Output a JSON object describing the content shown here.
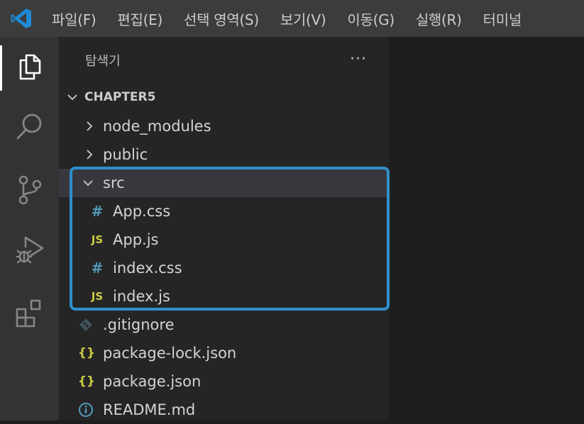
{
  "menu": {
    "items": [
      "파일(F)",
      "편집(E)",
      "선택 영역(S)",
      "보기(V)",
      "이동(G)",
      "실행(R)",
      "터미널"
    ]
  },
  "activity": {
    "icons": [
      "files-icon",
      "search-icon",
      "source-control-icon",
      "run-debug-icon",
      "extensions-icon"
    ]
  },
  "explorer": {
    "title": "탐색기",
    "more": "···",
    "root": "CHAPTER5",
    "items": [
      {
        "label": "node_modules",
        "icon": "chevron-right-icon"
      },
      {
        "label": "public",
        "icon": "chevron-right-icon"
      },
      {
        "label": "src",
        "icon": "chevron-down-icon"
      },
      {
        "label": "App.css",
        "icon": "css-file-icon",
        "glyph": "#"
      },
      {
        "label": "App.js",
        "icon": "js-file-icon",
        "glyph": "JS"
      },
      {
        "label": "index.css",
        "icon": "css-file-icon",
        "glyph": "#"
      },
      {
        "label": "index.js",
        "icon": "js-file-icon",
        "glyph": "JS"
      },
      {
        "label": ".gitignore",
        "icon": "git-file-icon"
      },
      {
        "label": "package-lock.json",
        "icon": "json-file-icon",
        "glyph": "{}"
      },
      {
        "label": "package.json",
        "icon": "json-file-icon",
        "glyph": "{}"
      },
      {
        "label": "README.md",
        "icon": "info-icon"
      }
    ]
  },
  "colors": {
    "titlebar": "#3c3c3c",
    "activitybar": "#333333",
    "sidebar": "#252526",
    "editor": "#1e1e1e",
    "highlight": "#2d8fcb",
    "css_icon": "#519aba",
    "js_icon": "#cbcb41"
  }
}
